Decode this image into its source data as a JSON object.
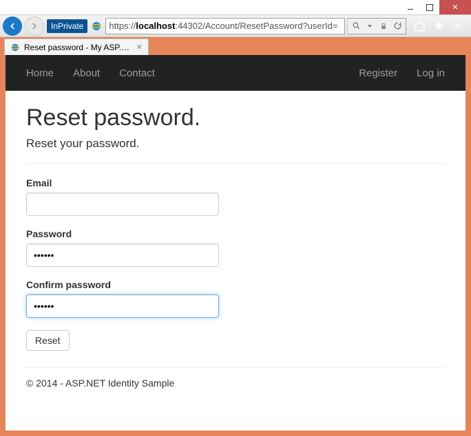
{
  "window": {
    "inprivate_label": "InPrivate",
    "url_protocol": "https://",
    "url_host": "localhost",
    "url_path": ":44302/Account/ResetPassword?userId=",
    "tab_title": "Reset password - My ASP.N..."
  },
  "nav": {
    "left": [
      "Home",
      "About",
      "Contact"
    ],
    "right": [
      "Register",
      "Log in"
    ]
  },
  "page": {
    "heading": "Reset password.",
    "subtitle": "Reset your password.",
    "email_label": "Email",
    "email_value": "",
    "password_label": "Password",
    "password_value": "••••••",
    "confirm_label": "Confirm password",
    "confirm_value": "••••••",
    "reset_button": "Reset",
    "footer": "© 2014 - ASP.NET Identity Sample"
  }
}
